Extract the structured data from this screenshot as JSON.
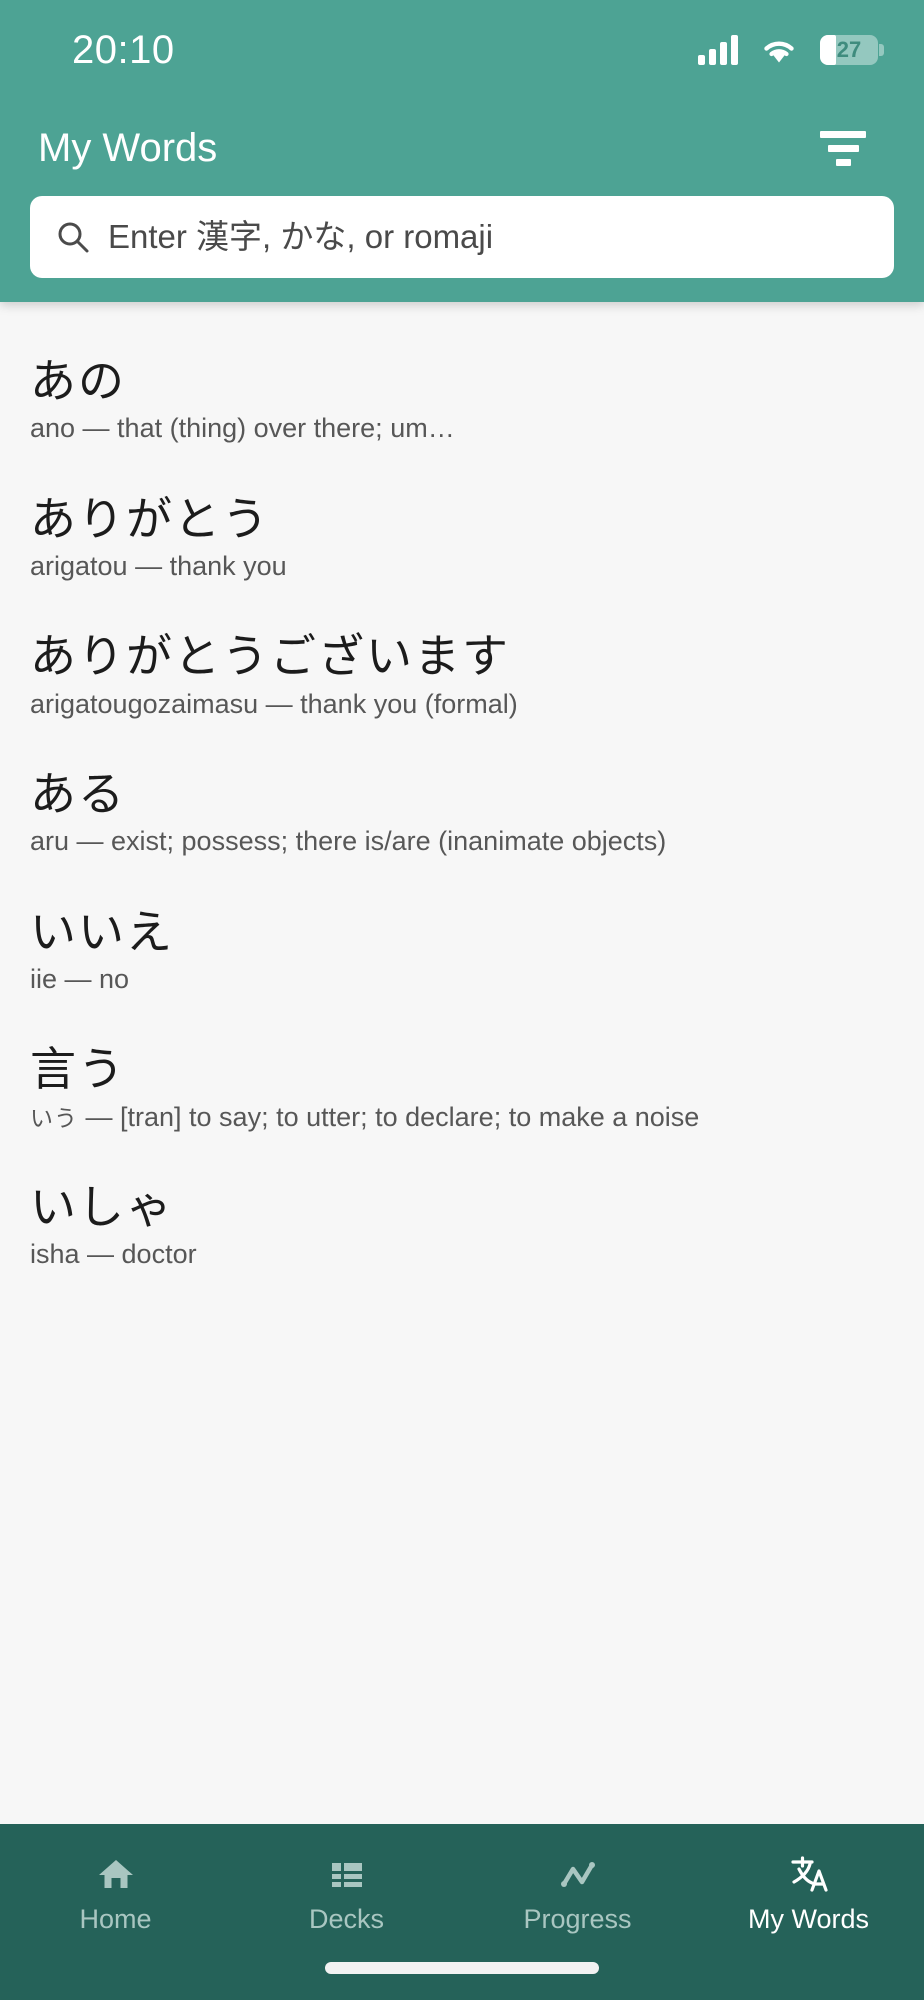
{
  "status_bar": {
    "time": "20:10",
    "battery_percent": "27",
    "signal_icon": "signal-bars-icon",
    "wifi_icon": "wifi-icon",
    "battery_icon": "battery-icon"
  },
  "header": {
    "title": "My Words",
    "filter_icon": "filter-list-icon",
    "background_color": "#4da394"
  },
  "search": {
    "placeholder": "Enter 漢字, かな, or romaji",
    "value": "",
    "icon": "search-icon"
  },
  "words": [
    {
      "term": "あの",
      "gloss": "ano — that (thing) over there; um…"
    },
    {
      "term": "ありがとう",
      "gloss": "arigatou — thank you"
    },
    {
      "term": "ありがとうございます",
      "gloss": "arigatougozaimasu — thank you (formal)"
    },
    {
      "term": "ある",
      "gloss": "aru — exist; possess; there is/are (inanimate objects)"
    },
    {
      "term": "いいえ",
      "gloss": "iie — no"
    },
    {
      "term": "言う",
      "reading_kana": "いう",
      "gloss": " — [tran] to say; to utter; to declare; to make a noise"
    },
    {
      "term": "いしゃ",
      "gloss": "isha — doctor"
    }
  ],
  "bottom_nav": {
    "background_color": "#256259",
    "active_color": "#ffffff",
    "inactive_color": "#a9c6c1",
    "items": [
      {
        "label": "Home",
        "icon": "home-icon",
        "active": false
      },
      {
        "label": "Decks",
        "icon": "list-icon",
        "active": false
      },
      {
        "label": "Progress",
        "icon": "line-chart-icon",
        "active": false
      },
      {
        "label": "My Words",
        "icon": "translate-icon",
        "active": true
      }
    ]
  }
}
